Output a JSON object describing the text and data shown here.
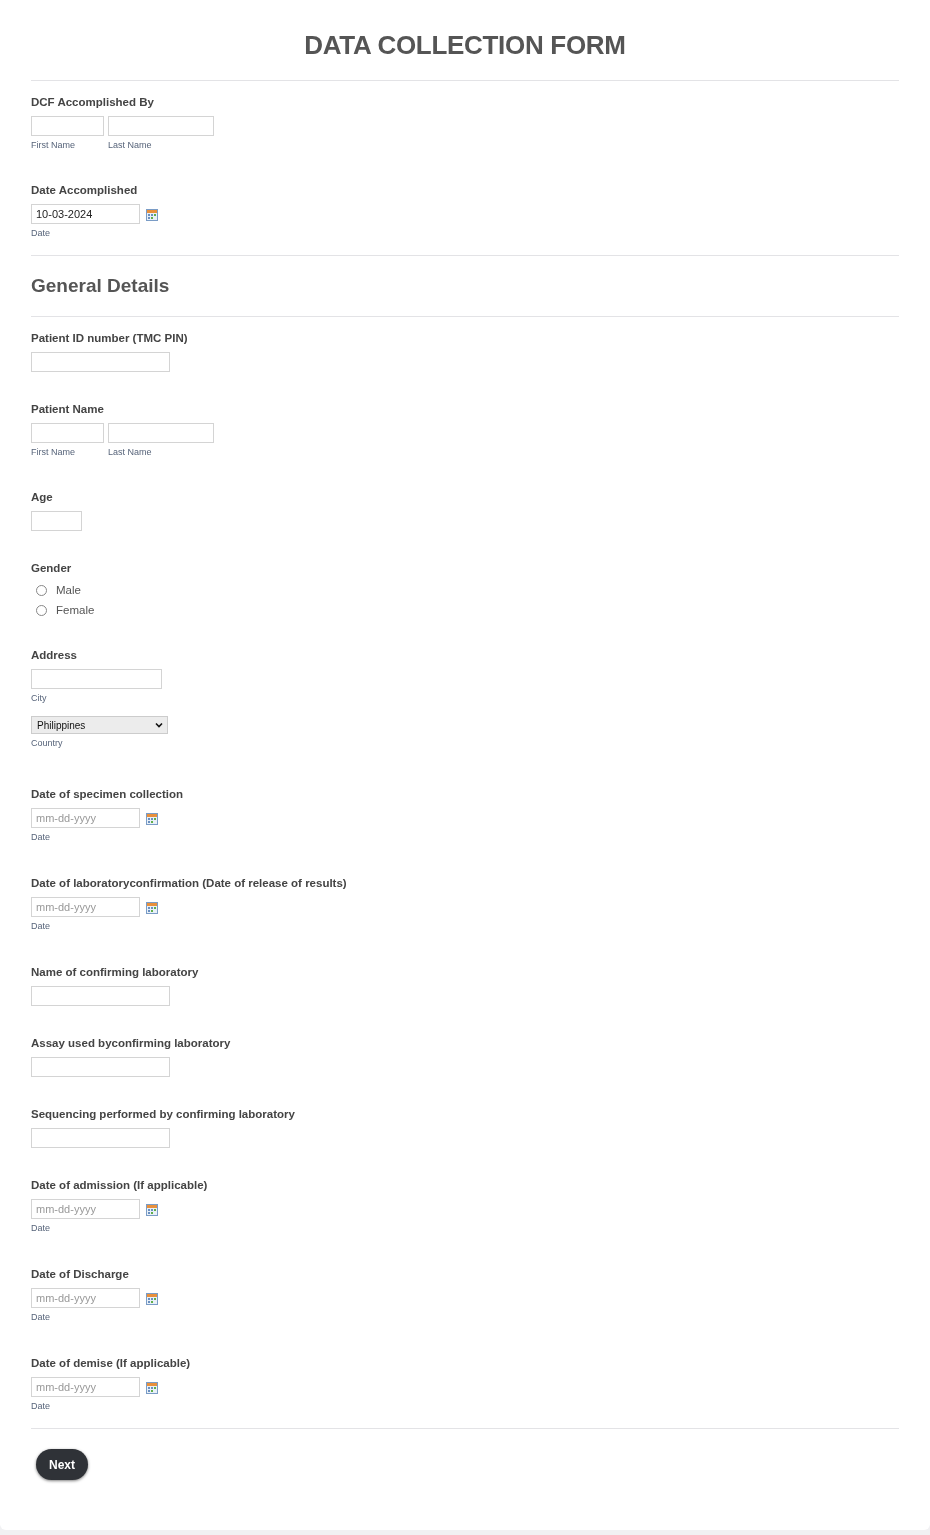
{
  "title": "DATA COLLECTION FORM",
  "fields": [
    {
      "kind": "name",
      "label": "DCF Accomplished By",
      "sublabels": [
        "First Name",
        "Last Name"
      ]
    },
    {
      "kind": "date",
      "label": "Date Accomplished",
      "value": "10-03-2024",
      "sublabel": "Date"
    }
  ],
  "section": {
    "title": "General Details",
    "fields": [
      {
        "kind": "text",
        "label": "Patient ID number (TMC PIN)"
      },
      {
        "kind": "name",
        "label": "Patient Name",
        "sublabels": [
          "First Name",
          "Last Name"
        ]
      },
      {
        "kind": "age",
        "label": "Age"
      },
      {
        "kind": "radio",
        "label": "Gender",
        "options": [
          {
            "label": "Male",
            "selected": false
          },
          {
            "label": "Female",
            "selected": false
          }
        ]
      },
      {
        "kind": "address",
        "label": "Address",
        "city_sublabel": "City",
        "country": "Philippines",
        "country_sublabel": "Country"
      },
      {
        "kind": "date",
        "label": "Date of specimen collection",
        "placeholder": "mm-dd-yyyy",
        "sublabel": "Date"
      },
      {
        "kind": "date",
        "label": "Date of laboratoryconfirmation (Date of release of results)",
        "placeholder": "mm-dd-yyyy",
        "sublabel": "Date"
      },
      {
        "kind": "text",
        "label": "Name of confirming laboratory"
      },
      {
        "kind": "text",
        "label": "Assay used byconfirming laboratory"
      },
      {
        "kind": "text",
        "label": "Sequencing performed by confirming laboratory"
      },
      {
        "kind": "date",
        "label": "Date of admission (If applicable)",
        "placeholder": "mm-dd-yyyy",
        "sublabel": "Date"
      },
      {
        "kind": "date",
        "label": "Date of Discharge",
        "placeholder": "mm-dd-yyyy",
        "sublabel": "Date"
      },
      {
        "kind": "date",
        "label": "Date of demise (If applicable)",
        "placeholder": "mm-dd-yyyy",
        "sublabel": "Date"
      }
    ]
  },
  "next_button": "Next"
}
